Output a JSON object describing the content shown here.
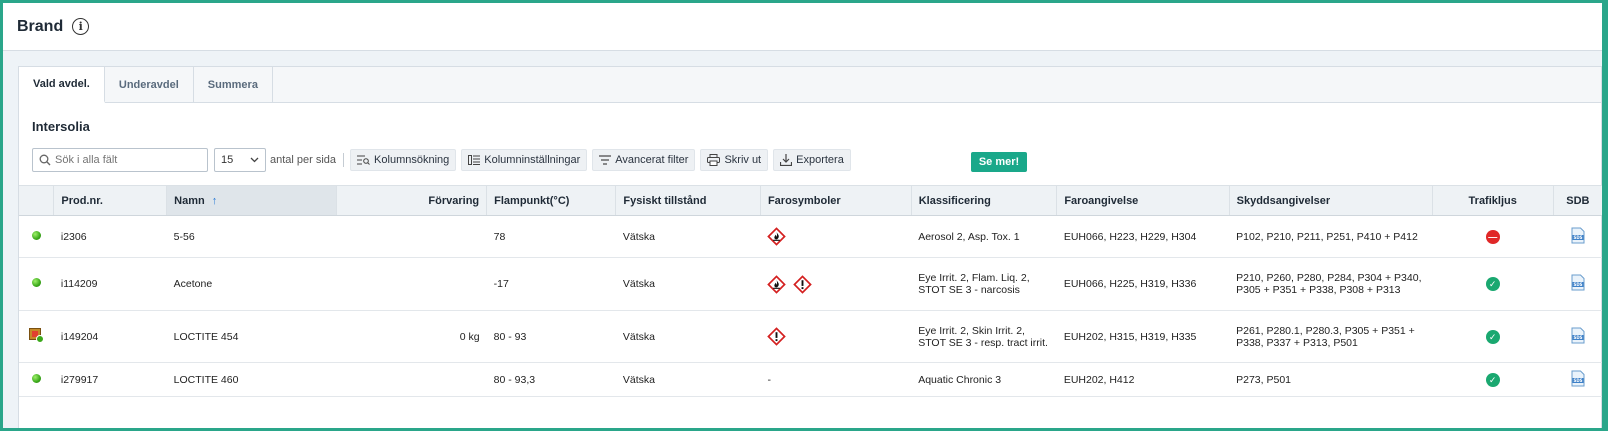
{
  "header": {
    "title": "Brand",
    "info_icon": "info-icon"
  },
  "tabs": [
    {
      "label": "Vald avdel."
    },
    {
      "label": "Underavdel"
    },
    {
      "label": "Summera"
    }
  ],
  "section_title": "Intersolia",
  "toolbar": {
    "search_placeholder": "Sök i alla fält",
    "page_size": "15",
    "per_page_label": "antal per sida",
    "column_search": "Kolumnsökning",
    "column_settings": "Kolumninställningar",
    "advanced_filter": "Avancerat filter",
    "print": "Skriv ut",
    "export": "Exportera",
    "see_more": "Se mer!"
  },
  "columns": [
    "",
    "Prod.nr.",
    "Namn",
    "Förvaring",
    "Flampunkt(°C)",
    "Fysiskt tillstånd",
    "Farosymboler",
    "Klassificering",
    "Faroangivelse",
    "Skyddsangivelser",
    "Trafikljus",
    "SDB"
  ],
  "rows": [
    {
      "status": "green-dot",
      "prodnr": "i2306",
      "name": "5-56",
      "storage": "",
      "flashpoint": "78",
      "state": "Vätska",
      "symbols": [
        "flammable"
      ],
      "classification": "Aerosol 2, Asp. Tox. 1",
      "hazard": "EUH066, H223, H229, H304",
      "precaution": "P102, P210, P211, P251, P410 + P412",
      "traffic": "red"
    },
    {
      "status": "green-dot",
      "prodnr": "i114209",
      "name": "Acetone",
      "storage": "",
      "flashpoint": "-17",
      "state": "Vätska",
      "symbols": [
        "flammable",
        "exclamation"
      ],
      "classification": "Eye Irrit. 2, Flam. Liq. 2, STOT SE 3 - narcosis",
      "hazard": "EUH066, H225, H319, H336",
      "precaution": "P210, P260, P280, P284, P304 + P340, P305 + P351 + P338, P308 + P313",
      "traffic": "green"
    },
    {
      "status": "storage-icon",
      "prodnr": "i149204",
      "name": "LOCTITE 454",
      "storage": "0 kg",
      "flashpoint": "80 - 93",
      "state": "Vätska",
      "symbols": [
        "exclamation"
      ],
      "classification": "Eye Irrit. 2, Skin Irrit. 2, STOT SE 3 - resp. tract irrit.",
      "hazard": "EUH202, H315, H319, H335",
      "precaution": "P261, P280.1, P280.3, P305 + P351 + P338, P337 + P313, P501",
      "traffic": "green"
    },
    {
      "status": "green-dot",
      "prodnr": "i279917",
      "name": "LOCTITE 460",
      "storage": "",
      "flashpoint": "80 - 93,3",
      "state": "Vätska",
      "symbols_text": "-",
      "symbols": [],
      "classification": "Aquatic Chronic 3",
      "hazard": "EUH202, H412",
      "precaution": "P273, P501",
      "traffic": "green"
    }
  ],
  "colors": {
    "accent": "#1aa88a",
    "red": "#e02828",
    "green": "#1aa870"
  }
}
